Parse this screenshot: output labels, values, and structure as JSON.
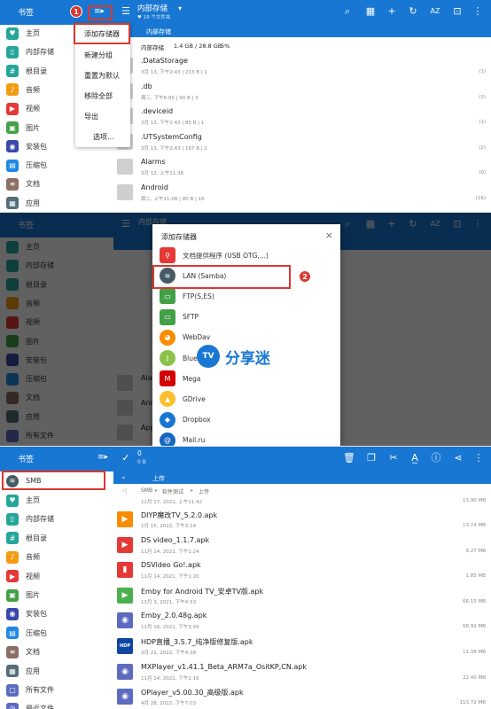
{
  "panel1": {
    "sidebar": {
      "title": "书签",
      "items": [
        {
          "label": "主页",
          "color": "#26a69a",
          "glyph": "♥"
        },
        {
          "label": "内部存储",
          "color": "#26a69a",
          "glyph": "▯"
        },
        {
          "label": "根目录",
          "color": "#26a69a",
          "glyph": "#"
        },
        {
          "label": "音频",
          "color": "#f39c12",
          "glyph": "♪"
        },
        {
          "label": "视频",
          "color": "#e53935",
          "glyph": "▶"
        },
        {
          "label": "图片",
          "color": "#43a047",
          "glyph": "▣"
        },
        {
          "label": "安装包",
          "color": "#3949ab",
          "glyph": "◉"
        },
        {
          "label": "压缩包",
          "color": "#1e88e5",
          "glyph": "▤"
        },
        {
          "label": "文档",
          "color": "#8d6e63",
          "glyph": "≡"
        },
        {
          "label": "应用",
          "color": "#546e7a",
          "glyph": "▦"
        }
      ]
    },
    "badge": "1",
    "toolbar": {
      "title": "内部存储",
      "subtitle": "♥ 19 个文件夹"
    },
    "tab": "内部存储",
    "storage": {
      "name": "内部存储",
      "size": "1.4 GB / 28.8 GB",
      "percent": "5%"
    },
    "menu": [
      "添加存储器",
      "新建分组",
      "重置为默认",
      "移除全部",
      "导出",
      "选项..."
    ],
    "files": [
      {
        "name": ".DataStorage",
        "meta": "3月 13, 下午2:43 | 213 B | 1",
        "right": "(1)"
      },
      {
        "name": ".db",
        "meta": "周三, 下午6:05 | 90 B | 3",
        "right": "(3)"
      },
      {
        "name": ".deviceid",
        "meta": "3月 13, 下午2:43 | 85 B | 1",
        "right": "(1)"
      },
      {
        "name": ".UTSystemConfig",
        "meta": "3月 13, 下午2:43 | 167 B | 2",
        "right": "(2)"
      },
      {
        "name": "Alarms",
        "meta": "3月 12, 上午11:36",
        "right": "(0)"
      },
      {
        "name": "Android",
        "meta": "周二, 上午11:08 | 80 B | 16",
        "right": "(16)"
      }
    ]
  },
  "panel2": {
    "dialog_title": "添加存储器",
    "badge": "2",
    "options": [
      {
        "label": "文档提供程序 (USB OTG,...)",
        "color": "#e53935",
        "glyph": "⚲",
        "square": true
      },
      {
        "label": "LAN (Samba)",
        "color": "#455a64",
        "glyph": "≋",
        "square": false
      },
      {
        "label": "FTP(S,ES)",
        "color": "#43a047",
        "glyph": "▭",
        "square": true
      },
      {
        "label": "SFTP",
        "color": "#43a047",
        "glyph": "▭",
        "square": true
      },
      {
        "label": "WebDav",
        "color": "#fb8c00",
        "glyph": "◕",
        "square": false
      },
      {
        "label": "Blue",
        "color": "#8bc34a",
        "glyph": "ᛒ",
        "square": false
      },
      {
        "label": "Mega",
        "color": "#d50000",
        "glyph": "M",
        "square": true
      },
      {
        "label": "GDrive",
        "color": "#fbc02d",
        "glyph": "▲",
        "square": false
      },
      {
        "label": "Dropbox",
        "color": "#1976d2",
        "glyph": "◆",
        "square": false
      },
      {
        "label": "Mail.ru",
        "color": "#1565c0",
        "glyph": "@",
        "square": false
      }
    ],
    "watermark": "分享迷",
    "watermark_logo": "TV",
    "bg_sidebar": [
      "书签",
      "主页",
      "内部存储",
      "根目录",
      "音频",
      "视频",
      "图片",
      "安装包",
      "压缩包",
      "文档",
      "应用",
      "所有文件"
    ],
    "bg_main": [
      "内部存储",
      "Ala",
      "And",
      "App"
    ]
  },
  "panel3": {
    "sidebar": {
      "title": "书签",
      "smb": "SMB",
      "items": [
        {
          "label": "主页",
          "color": "#26a69a",
          "glyph": "♥"
        },
        {
          "label": "内部存储",
          "color": "#26a69a",
          "glyph": "▯"
        },
        {
          "label": "根目录",
          "color": "#26a69a",
          "glyph": "#"
        },
        {
          "label": "音频",
          "color": "#f39c12",
          "glyph": "♪"
        },
        {
          "label": "视频",
          "color": "#e53935",
          "glyph": "▶"
        },
        {
          "label": "图片",
          "color": "#43a047",
          "glyph": "▣"
        },
        {
          "label": "安装包",
          "color": "#3949ab",
          "glyph": "◉"
        },
        {
          "label": "压缩包",
          "color": "#1e88e5",
          "glyph": "▤"
        },
        {
          "label": "文档",
          "color": "#8d6e63",
          "glyph": "≡"
        },
        {
          "label": "应用",
          "color": "#546e7a",
          "glyph": "▦"
        },
        {
          "label": "所有文件",
          "color": "#5c6bc0",
          "glyph": "▢"
        },
        {
          "label": "最近文件",
          "color": "#5c6bc0",
          "glyph": "◷"
        }
      ]
    },
    "selection": {
      "count": "0",
      "size": "0 B"
    },
    "tab": "上传",
    "breadcrumb": [
      "SMB",
      "软件测试",
      "上传"
    ],
    "top_partial": {
      "meta": "12月 17, 2021, 上午11:42",
      "right": "13.90 MB"
    },
    "files": [
      {
        "name": "DIYP魔改TV_5.2.0.apk",
        "meta": "1月 15, 2022, 下午3:14",
        "right": "13.74 MB",
        "color": "#fb8c00",
        "glyph": "▶"
      },
      {
        "name": "DS video_1.1.7.apk",
        "meta": "11月 14, 2021, 下午1:24",
        "right": "9.27 MB",
        "color": "#e53935",
        "glyph": "▶"
      },
      {
        "name": "DSVideo Go!.apk",
        "meta": "11月 14, 2021, 下午1:20",
        "right": "1.85 MB",
        "color": "#e53935",
        "glyph": "▮"
      },
      {
        "name": "Emby for Android TV_安卓TV版.apk",
        "meta": "12月 3, 2021, 下午4:53",
        "right": "66.15 MB",
        "color": "#4caf50",
        "glyph": "▶"
      },
      {
        "name": "Emby_2.0.48g.apk",
        "meta": "11月 16, 2021, 下午3:09",
        "right": "68.92 MB",
        "color": "#5c6bc0",
        "glyph": "◉"
      },
      {
        "name": "HDP直播_3.5.7_纯净版修复版.apk",
        "meta": "3月 21, 2022, 下午4:38",
        "right": "11.38 MB",
        "color": "#0d47a1",
        "glyph": "HDP"
      },
      {
        "name": "MXPlayer_v1.41.1_Beta_ARM7a_OsitKP,CN.apk",
        "meta": "11月 14, 2021, 下午2:16",
        "right": "22.40 MB",
        "color": "#5c6bc0",
        "glyph": "◉"
      },
      {
        "name": "OPlayer_v5.00.30_高级版.apk",
        "meta": "4月 28, 2022, 下午7:03",
        "right": "113.72 MB",
        "color": "#5c6bc0",
        "glyph": "◉"
      }
    ]
  }
}
